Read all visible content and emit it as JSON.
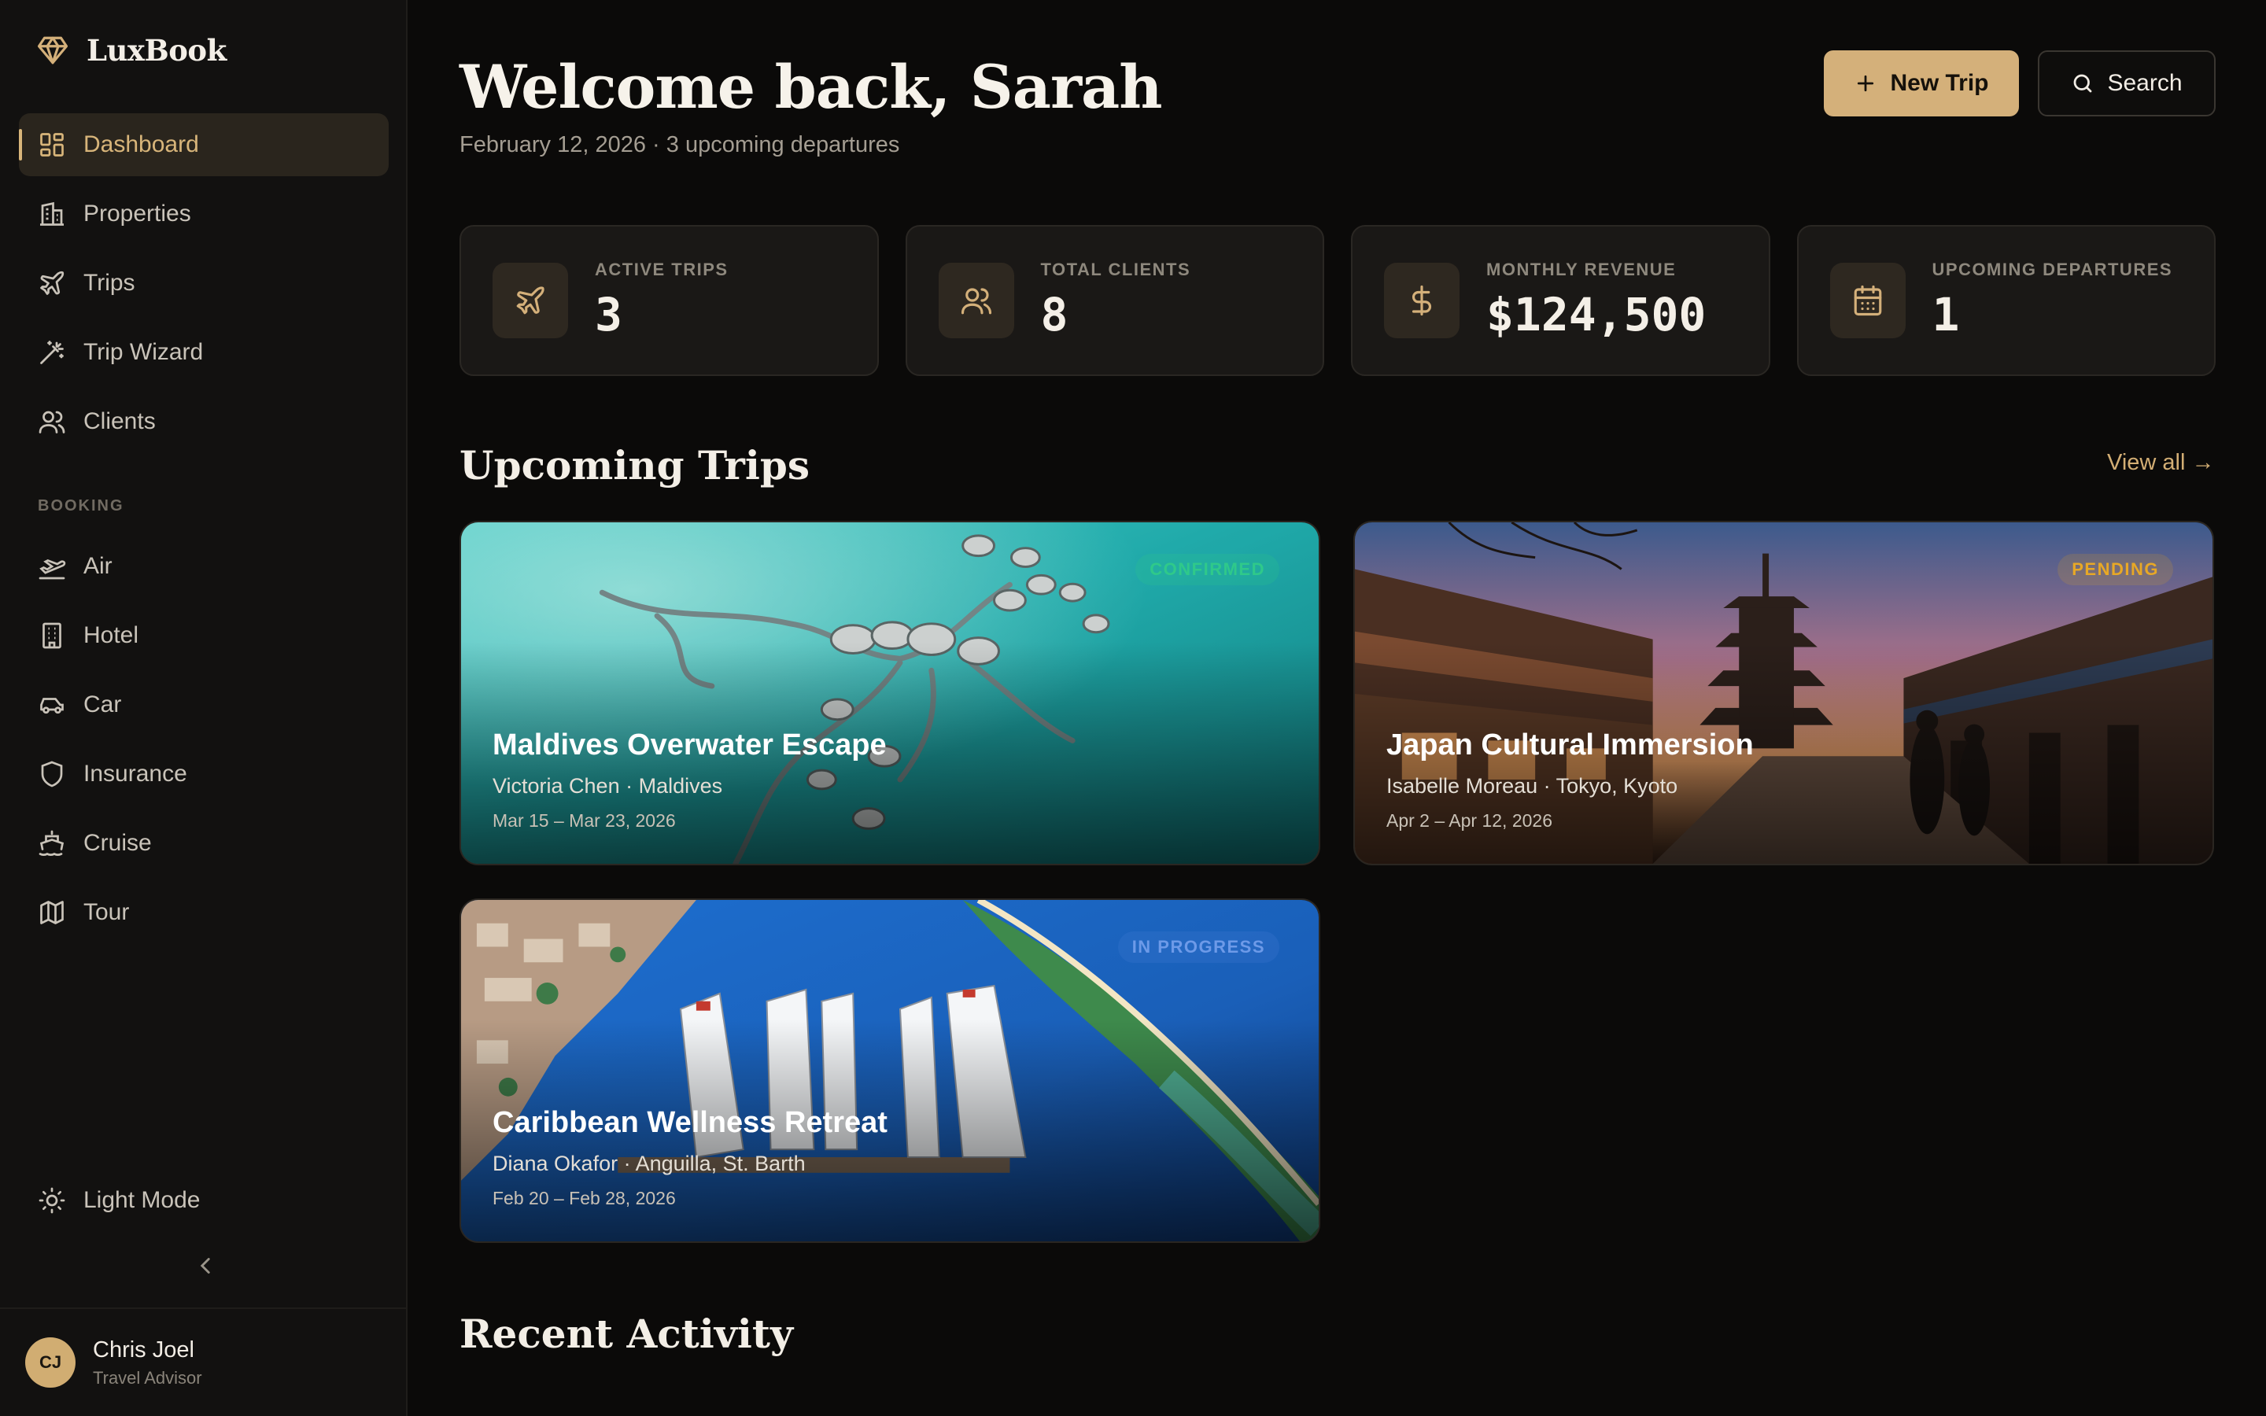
{
  "brand": {
    "name": "LuxBook"
  },
  "sidebar": {
    "items": [
      {
        "label": "Dashboard",
        "icon": "dashboard-icon",
        "active": true
      },
      {
        "label": "Properties",
        "icon": "building-icon"
      },
      {
        "label": "Trips",
        "icon": "plane-icon"
      },
      {
        "label": "Trip Wizard",
        "icon": "wand-icon"
      },
      {
        "label": "Clients",
        "icon": "users-icon"
      }
    ],
    "section_label": "BOOKING",
    "booking_items": [
      {
        "label": "Air",
        "icon": "plane-takeoff-icon"
      },
      {
        "label": "Hotel",
        "icon": "hotel-icon"
      },
      {
        "label": "Car",
        "icon": "car-icon"
      },
      {
        "label": "Insurance",
        "icon": "shield-icon"
      },
      {
        "label": "Cruise",
        "icon": "ship-icon"
      },
      {
        "label": "Tour",
        "icon": "map-icon"
      }
    ],
    "light_mode": "Light Mode",
    "user": {
      "initials": "CJ",
      "name": "Chris Joel",
      "role": "Travel Advisor"
    }
  },
  "header": {
    "title": "Welcome back, Sarah",
    "subtitle": "February 12, 2026 · 3 upcoming departures",
    "new_trip": "New Trip",
    "search": "Search"
  },
  "stats": [
    {
      "label": "ACTIVE TRIPS",
      "value": "3",
      "icon": "plane-icon"
    },
    {
      "label": "TOTAL CLIENTS",
      "value": "8",
      "icon": "users-icon"
    },
    {
      "label": "MONTHLY REVENUE",
      "value": "$124,500",
      "icon": "dollar-icon"
    },
    {
      "label": "UPCOMING DEPARTURES",
      "value": "1",
      "icon": "calendar-icon"
    }
  ],
  "upcoming": {
    "title": "Upcoming Trips",
    "view_all": "View all →",
    "trips": [
      {
        "title": "Maldives Overwater Escape",
        "subtitle": "Victoria Chen · Maldives",
        "dates": "Mar 15 – Mar 23, 2026",
        "status": "CONFIRMED"
      },
      {
        "title": "Japan Cultural Immersion",
        "subtitle": "Isabelle Moreau · Tokyo, Kyoto",
        "dates": "Apr 2 – Apr 12, 2026",
        "status": "PENDING"
      },
      {
        "title": "Caribbean Wellness Retreat",
        "subtitle": "Diana Okafor · Anguilla, St. Barth",
        "dates": "Feb 20 – Feb 28, 2026",
        "status": "IN PROGRESS"
      }
    ]
  },
  "recent": {
    "title": "Recent Activity"
  },
  "colors": {
    "accent": "#d4b07a",
    "background": "#0b0a09",
    "confirmed": "#2fc98a",
    "pending": "#e0a321",
    "in_progress": "#5b8de6"
  }
}
